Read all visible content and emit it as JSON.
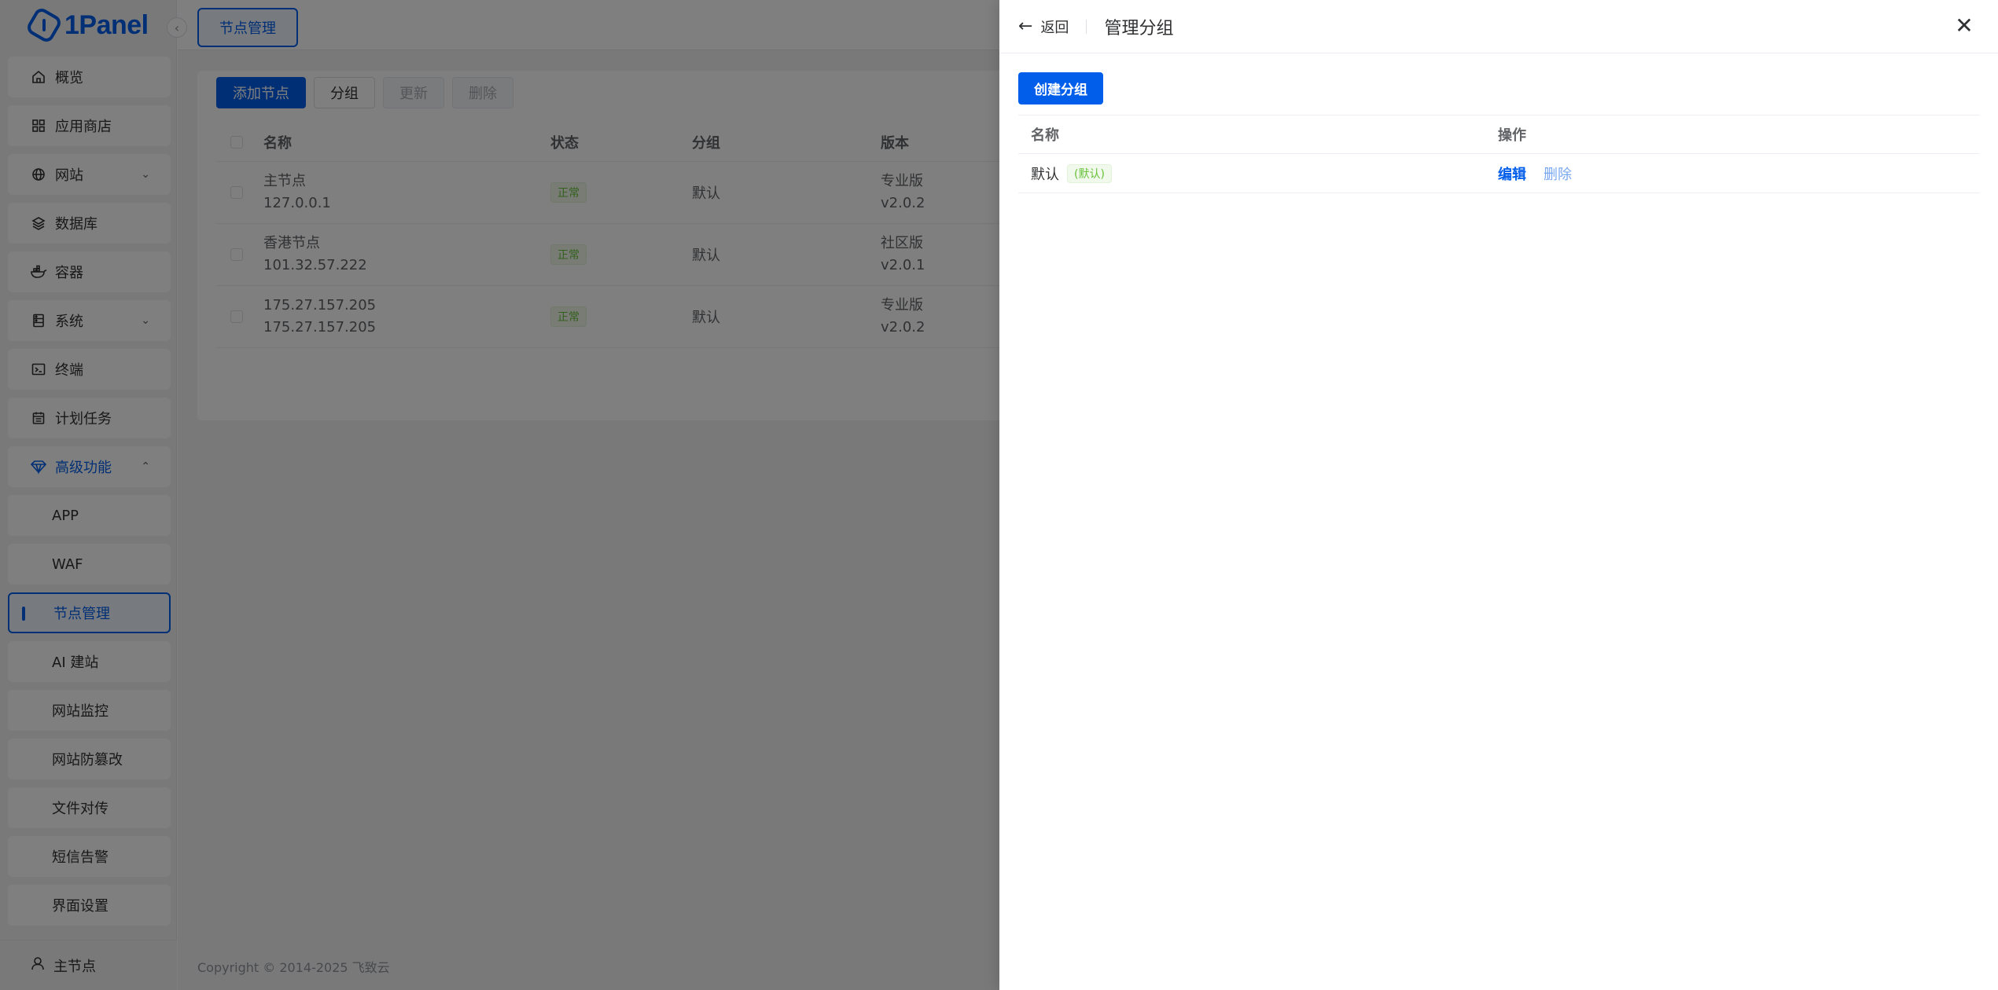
{
  "app": {
    "logo_text": "1Panel"
  },
  "sidebar": {
    "items": [
      {
        "label": "概览",
        "icon": "home-icon"
      },
      {
        "label": "应用商店",
        "icon": "grid-icon"
      },
      {
        "label": "网站",
        "icon": "globe-icon"
      },
      {
        "label": "数据库",
        "icon": "layers-icon"
      },
      {
        "label": "容器",
        "icon": "docker-icon"
      },
      {
        "label": "系统",
        "icon": "server-icon"
      },
      {
        "label": "终端",
        "icon": "terminal-icon"
      },
      {
        "label": "计划任务",
        "icon": "calendar-icon"
      },
      {
        "label": "高级功能",
        "icon": "diamond-icon"
      }
    ],
    "sub_items": [
      "APP",
      "WAF",
      "节点管理",
      "AI 建站",
      "网站监控",
      "网站防篡改",
      "文件对传",
      "短信告警",
      "界面设置"
    ],
    "footer_label": "主节点"
  },
  "topbar": {
    "tab_label": "节点管理"
  },
  "toolbar": {
    "add": "添加节点",
    "group": "分组",
    "update": "更新",
    "delete": "删除"
  },
  "nodes_table": {
    "headers": [
      "名称",
      "状态",
      "分组",
      "版本"
    ],
    "rows": [
      {
        "name": "主节点",
        "ip": "127.0.0.1",
        "status": "正常",
        "group": "默认",
        "edition": "专业版",
        "version": "v2.0.2"
      },
      {
        "name": "香港节点",
        "ip": "101.32.57.222",
        "status": "正常",
        "group": "默认",
        "edition": "社区版",
        "version": "v2.0.1"
      },
      {
        "name": "175.27.157.205",
        "ip": "175.27.157.205",
        "status": "正常",
        "group": "默认",
        "edition": "专业版",
        "version": "v2.0.2"
      }
    ]
  },
  "copyright": "Copyright © 2014-2025 飞致云",
  "drawer": {
    "back_label": "返回",
    "title": "管理分组",
    "create_button": "创建分组",
    "headers": [
      "名称",
      "操作"
    ],
    "rows": [
      {
        "name": "默认",
        "tag": "(默认)",
        "edit": "编辑",
        "delete": "删除"
      }
    ]
  },
  "colors": {
    "primary": "#005eeb",
    "success": "#67c23a",
    "mask": "rgba(0,0,0,0.5)"
  }
}
